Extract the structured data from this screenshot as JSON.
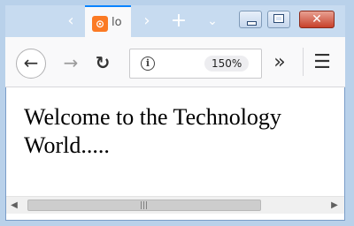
{
  "window": {
    "tab_title": "lo",
    "favicon_letter": "⊙",
    "close_glyph": "✕"
  },
  "tabstrip": {
    "prev_icon": "chevron-left-icon",
    "next_icon": "chevron-right-icon",
    "new_tab_icon": "plus-icon",
    "all_tabs_icon": "chevron-down-icon"
  },
  "toolbar": {
    "back_icon": "arrow-left-icon",
    "forward_icon": "arrow-right-icon",
    "reload_icon": "reload-icon",
    "zoom_level": "150%",
    "overflow_icon": "double-chevron-right-icon",
    "menu_icon": "hamburger-menu-icon"
  },
  "page": {
    "heading": "Welcome to the Technology World....."
  },
  "scrollbar": {
    "left_arrow_icon": "triangle-left-icon",
    "right_arrow_icon": "triangle-right-icon",
    "grip": "|||"
  },
  "colors": {
    "frame": "#b9d1ea",
    "tabstrip": "#c7dbf0",
    "active_tab_accent": "#0a84ff",
    "favicon": "#fb7a24",
    "close_button": "#c7402a"
  }
}
